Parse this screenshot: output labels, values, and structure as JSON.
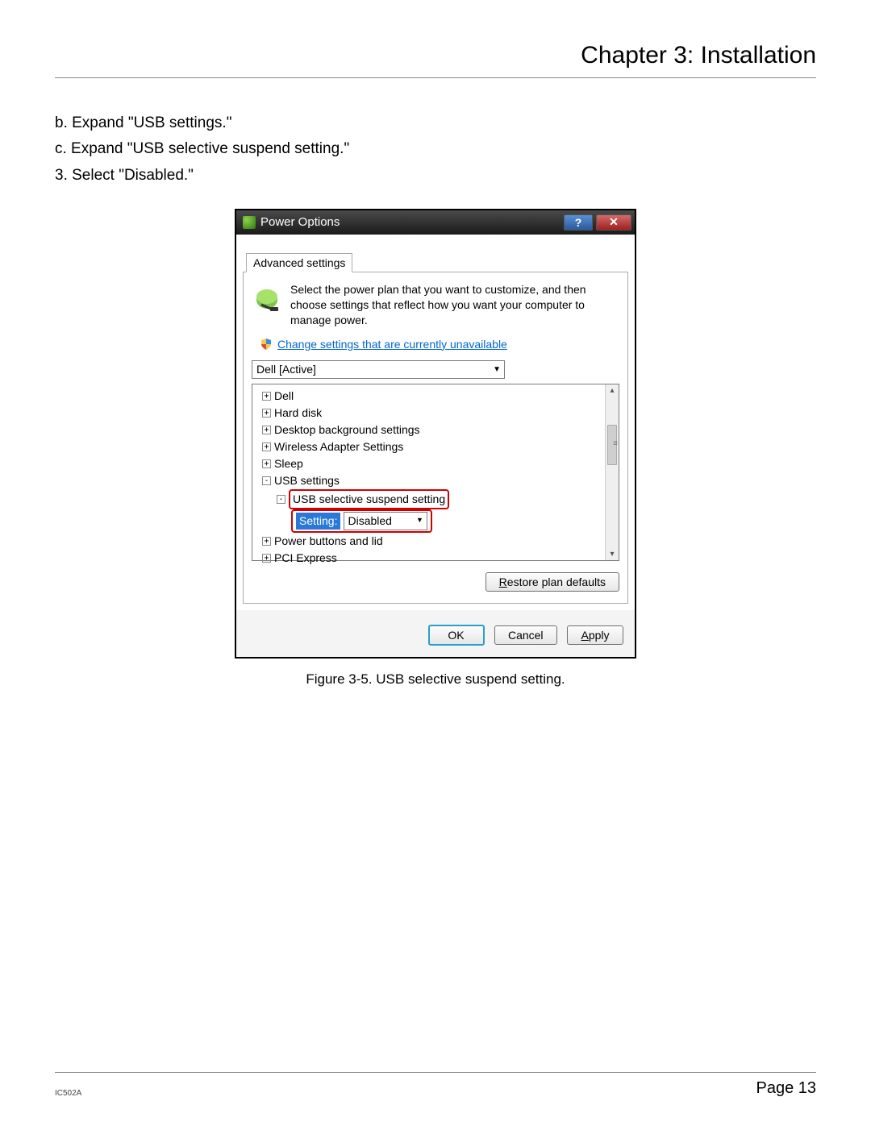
{
  "header": {
    "chapter": "Chapter 3: Installation"
  },
  "steps": {
    "b": "b. Expand \"USB settings.\"",
    "c": "c. Expand \"USB selective suspend setting.\"",
    "s3": "3. Select \"Disabled.\""
  },
  "dialog": {
    "title": "Power Options",
    "tab": "Advanced settings",
    "instruction": "Select the power plan that you want to customize, and then choose settings that reflect how you want your computer to manage power.",
    "change_link": "Change settings that are currently unavailable",
    "plan": "Dell [Active]",
    "tree": {
      "n0": "Dell",
      "n1": "Hard disk",
      "n2": "Desktop background settings",
      "n3": "Wireless Adapter Settings",
      "n4": "Sleep",
      "n5": "USB settings",
      "n5a": "USB selective suspend setting",
      "setting_label": "Setting:",
      "setting_value": "Disabled",
      "n6": "Power buttons and lid",
      "n7": "PCI Express"
    },
    "restore": "Restore plan defaults",
    "ok": "OK",
    "cancel": "Cancel",
    "apply": "Apply"
  },
  "caption": "Figure 3-5. USB selective suspend setting.",
  "footer": {
    "code": "IC502A",
    "page": "Page 13"
  }
}
